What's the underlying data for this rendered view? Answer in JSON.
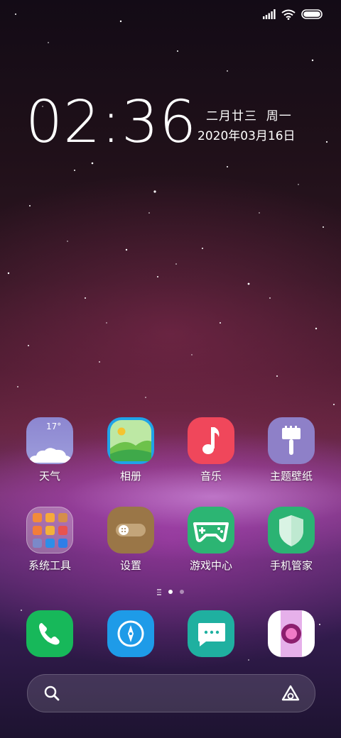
{
  "status_bar": {
    "icons": [
      "cellular-signal-icon",
      "wifi-icon",
      "battery-icon"
    ]
  },
  "clock": {
    "time": "02:36",
    "lunar_date": "二月廿三  周一",
    "date": "2020年03月16日"
  },
  "weather_widget": {
    "temperature": "17°"
  },
  "apps_row1": [
    {
      "label": "天气",
      "icon": "weather-icon"
    },
    {
      "label": "相册",
      "icon": "gallery-icon"
    },
    {
      "label": "音乐",
      "icon": "music-icon"
    },
    {
      "label": "主题壁纸",
      "icon": "themes-icon"
    }
  ],
  "apps_row2": [
    {
      "label": "系统工具",
      "icon": "system-tools-folder-icon"
    },
    {
      "label": "设置",
      "icon": "settings-icon"
    },
    {
      "label": "游戏中心",
      "icon": "game-center-icon"
    },
    {
      "label": "手机管家",
      "icon": "security-icon"
    }
  ],
  "page_indicator": {
    "pages": 3,
    "current_page": 2
  },
  "dock": [
    {
      "icon": "phone-icon"
    },
    {
      "icon": "browser-compass-icon"
    },
    {
      "icon": "messages-icon"
    },
    {
      "icon": "camera-icon"
    }
  ],
  "search_bar": {
    "left_icon": "search-icon",
    "right_icon": "assistant-icon"
  },
  "colors": {
    "phone": "#17b85a",
    "browser": "#1e9be8",
    "messages": "#1fb0a0",
    "music": "#f0475b",
    "themes": "#8e80c8",
    "game": "#2cb573",
    "security": "#2bb373",
    "settings": "#9a7647"
  }
}
